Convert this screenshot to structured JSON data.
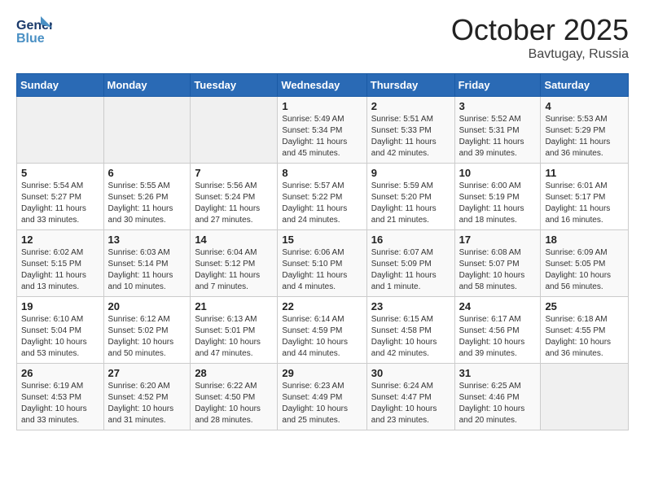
{
  "header": {
    "logo_line1": "General",
    "logo_line2": "Blue",
    "month_title": "October 2025",
    "location": "Bavtugay, Russia"
  },
  "days_of_week": [
    "Sunday",
    "Monday",
    "Tuesday",
    "Wednesday",
    "Thursday",
    "Friday",
    "Saturday"
  ],
  "weeks": [
    [
      {
        "day": "",
        "info": ""
      },
      {
        "day": "",
        "info": ""
      },
      {
        "day": "",
        "info": ""
      },
      {
        "day": "1",
        "info": "Sunrise: 5:49 AM\nSunset: 5:34 PM\nDaylight: 11 hours and 45 minutes."
      },
      {
        "day": "2",
        "info": "Sunrise: 5:51 AM\nSunset: 5:33 PM\nDaylight: 11 hours and 42 minutes."
      },
      {
        "day": "3",
        "info": "Sunrise: 5:52 AM\nSunset: 5:31 PM\nDaylight: 11 hours and 39 minutes."
      },
      {
        "day": "4",
        "info": "Sunrise: 5:53 AM\nSunset: 5:29 PM\nDaylight: 11 hours and 36 minutes."
      }
    ],
    [
      {
        "day": "5",
        "info": "Sunrise: 5:54 AM\nSunset: 5:27 PM\nDaylight: 11 hours and 33 minutes."
      },
      {
        "day": "6",
        "info": "Sunrise: 5:55 AM\nSunset: 5:26 PM\nDaylight: 11 hours and 30 minutes."
      },
      {
        "day": "7",
        "info": "Sunrise: 5:56 AM\nSunset: 5:24 PM\nDaylight: 11 hours and 27 minutes."
      },
      {
        "day": "8",
        "info": "Sunrise: 5:57 AM\nSunset: 5:22 PM\nDaylight: 11 hours and 24 minutes."
      },
      {
        "day": "9",
        "info": "Sunrise: 5:59 AM\nSunset: 5:20 PM\nDaylight: 11 hours and 21 minutes."
      },
      {
        "day": "10",
        "info": "Sunrise: 6:00 AM\nSunset: 5:19 PM\nDaylight: 11 hours and 18 minutes."
      },
      {
        "day": "11",
        "info": "Sunrise: 6:01 AM\nSunset: 5:17 PM\nDaylight: 11 hours and 16 minutes."
      }
    ],
    [
      {
        "day": "12",
        "info": "Sunrise: 6:02 AM\nSunset: 5:15 PM\nDaylight: 11 hours and 13 minutes."
      },
      {
        "day": "13",
        "info": "Sunrise: 6:03 AM\nSunset: 5:14 PM\nDaylight: 11 hours and 10 minutes."
      },
      {
        "day": "14",
        "info": "Sunrise: 6:04 AM\nSunset: 5:12 PM\nDaylight: 11 hours and 7 minutes."
      },
      {
        "day": "15",
        "info": "Sunrise: 6:06 AM\nSunset: 5:10 PM\nDaylight: 11 hours and 4 minutes."
      },
      {
        "day": "16",
        "info": "Sunrise: 6:07 AM\nSunset: 5:09 PM\nDaylight: 11 hours and 1 minute."
      },
      {
        "day": "17",
        "info": "Sunrise: 6:08 AM\nSunset: 5:07 PM\nDaylight: 10 hours and 58 minutes."
      },
      {
        "day": "18",
        "info": "Sunrise: 6:09 AM\nSunset: 5:05 PM\nDaylight: 10 hours and 56 minutes."
      }
    ],
    [
      {
        "day": "19",
        "info": "Sunrise: 6:10 AM\nSunset: 5:04 PM\nDaylight: 10 hours and 53 minutes."
      },
      {
        "day": "20",
        "info": "Sunrise: 6:12 AM\nSunset: 5:02 PM\nDaylight: 10 hours and 50 minutes."
      },
      {
        "day": "21",
        "info": "Sunrise: 6:13 AM\nSunset: 5:01 PM\nDaylight: 10 hours and 47 minutes."
      },
      {
        "day": "22",
        "info": "Sunrise: 6:14 AM\nSunset: 4:59 PM\nDaylight: 10 hours and 44 minutes."
      },
      {
        "day": "23",
        "info": "Sunrise: 6:15 AM\nSunset: 4:58 PM\nDaylight: 10 hours and 42 minutes."
      },
      {
        "day": "24",
        "info": "Sunrise: 6:17 AM\nSunset: 4:56 PM\nDaylight: 10 hours and 39 minutes."
      },
      {
        "day": "25",
        "info": "Sunrise: 6:18 AM\nSunset: 4:55 PM\nDaylight: 10 hours and 36 minutes."
      }
    ],
    [
      {
        "day": "26",
        "info": "Sunrise: 6:19 AM\nSunset: 4:53 PM\nDaylight: 10 hours and 33 minutes."
      },
      {
        "day": "27",
        "info": "Sunrise: 6:20 AM\nSunset: 4:52 PM\nDaylight: 10 hours and 31 minutes."
      },
      {
        "day": "28",
        "info": "Sunrise: 6:22 AM\nSunset: 4:50 PM\nDaylight: 10 hours and 28 minutes."
      },
      {
        "day": "29",
        "info": "Sunrise: 6:23 AM\nSunset: 4:49 PM\nDaylight: 10 hours and 25 minutes."
      },
      {
        "day": "30",
        "info": "Sunrise: 6:24 AM\nSunset: 4:47 PM\nDaylight: 10 hours and 23 minutes."
      },
      {
        "day": "31",
        "info": "Sunrise: 6:25 AM\nSunset: 4:46 PM\nDaylight: 10 hours and 20 minutes."
      },
      {
        "day": "",
        "info": ""
      }
    ]
  ]
}
